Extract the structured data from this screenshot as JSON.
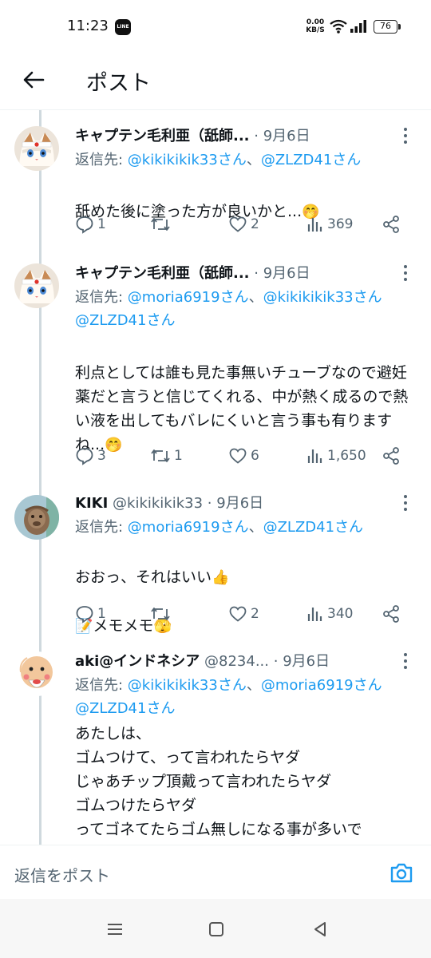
{
  "status_bar": {
    "time": "11:23",
    "line_app_label": "LINE",
    "net_speed_value": "0.00",
    "net_speed_unit": "KB/S",
    "battery": "76"
  },
  "header": {
    "title": "ポスト"
  },
  "tweets": [
    {
      "name": "キャプテン毛利亜（舐師...",
      "handle": "",
      "dot": "·",
      "date": "9月6日",
      "reply_prefix": "返信先: ",
      "mentions": [
        "@kikikikik33さん",
        "@ZLZD41さん"
      ],
      "separator": "、",
      "body": "舐めた後に塗った方が良いかと...",
      "emoji": "🤭",
      "replies": "1",
      "retweets": "",
      "likes": "2",
      "views": "369"
    },
    {
      "name": "キャプテン毛利亜（舐師...",
      "handle": "",
      "dot": "·",
      "date": "9月6日",
      "reply_prefix": "返信先: ",
      "mentions": [
        "@moria6919さん",
        "@kikikikik33さん",
        "@ZLZD41さん"
      ],
      "separator": "、",
      "body": "利点としては誰も見た事無いチューブなので避妊薬だと言うと信じてくれる、中が熱く成るので熱い液を出してもバレにくいと言う事も有りますね...",
      "emoji": "🤭",
      "replies": "3",
      "retweets": "1",
      "likes": "6",
      "views": "1,650"
    },
    {
      "name": "KIKI",
      "handle": "@kikikikik33",
      "dot": "·",
      "date": "9月6日",
      "reply_prefix": "返信先: ",
      "mentions": [
        "@moria6919さん",
        "@ZLZD41さん"
      ],
      "separator": "、",
      "body_line1": "おおっ、それはいい",
      "emoji_line1": "👍",
      "emoji_line2_prefix": "📝",
      "body_line2": "メモメモ",
      "emoji_line2": "🫣",
      "replies": "1",
      "retweets": "",
      "likes": "2",
      "views": "340"
    },
    {
      "name": "aki@インドネシア",
      "handle": "@8234...",
      "dot": "·",
      "date": "9月6日",
      "reply_prefix": "返信先: ",
      "mentions": [
        "@kikikikik33さん",
        "@moria6919さん",
        "@ZLZD41さん"
      ],
      "separator": "、",
      "body": "あたしは、\nゴムつけて、って言われたらヤダ\nじゃあチップ頂戴って言われたらヤダ\nゴムつけたらヤダ\nってゴネてたらゴム無しになる事が多いで"
    }
  ],
  "composer": {
    "placeholder": "返信をポスト"
  },
  "icons": {
    "back": "arrow-left-icon",
    "more": "more-vertical-icon",
    "reply": "speech-bubble-icon",
    "retweet": "retweet-icon",
    "like": "heart-icon",
    "views": "bar-chart-icon",
    "share": "share-icon",
    "camera": "camera-icon"
  },
  "colors": {
    "link": "#1d9bf0",
    "secondary_text": "#536471",
    "thread_line": "#cfd9de"
  }
}
